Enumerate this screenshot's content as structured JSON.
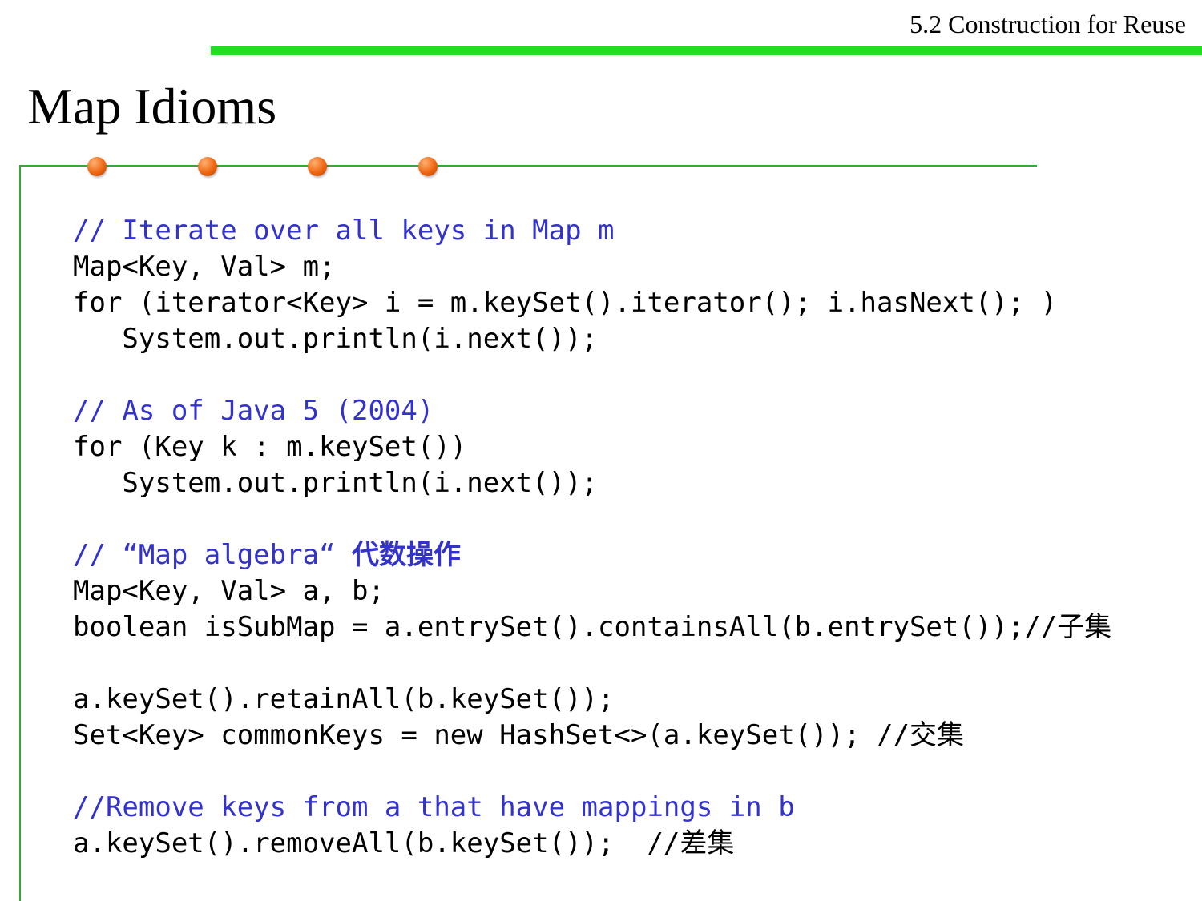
{
  "header": {
    "section": "5.2 Construction for Reuse"
  },
  "title": "Map Idioms",
  "colors": {
    "accent_green": "#22dd22",
    "frame_green": "#33aa33",
    "dot_orange": "#ee6611",
    "comment_blue": "#3333cc",
    "code_black": "#000000"
  },
  "code": {
    "line1": "// Iterate over all keys in Map m",
    "line2": "Map<Key, Val> m;",
    "line3": "for (iterator<Key> i = m.keySet().iterator(); i.hasNext(); )",
    "line4": "   System.out.println(i.next());",
    "line5": "",
    "line6": "// As of Java 5 (2004)",
    "line7": "for (Key k : m.keySet())",
    "line8": "   System.out.println(i.next());",
    "line9": "",
    "line10_text": "// “Map algebra“ ",
    "line10_cjk": "代数操作",
    "line11": "Map<Key, Val> a, b;",
    "line12": "boolean isSubMap = a.entrySet().containsAll(b.entrySet());//子集",
    "line13": "",
    "line14": "a.keySet().retainAll(b.keySet());",
    "line15": "Set<Key> commonKeys = new HashSet<>(a.keySet()); //交集",
    "line16": "",
    "line17": "//Remove keys from a that have mappings in b",
    "line18": "a.keySet().removeAll(b.keySet());  //差集"
  }
}
